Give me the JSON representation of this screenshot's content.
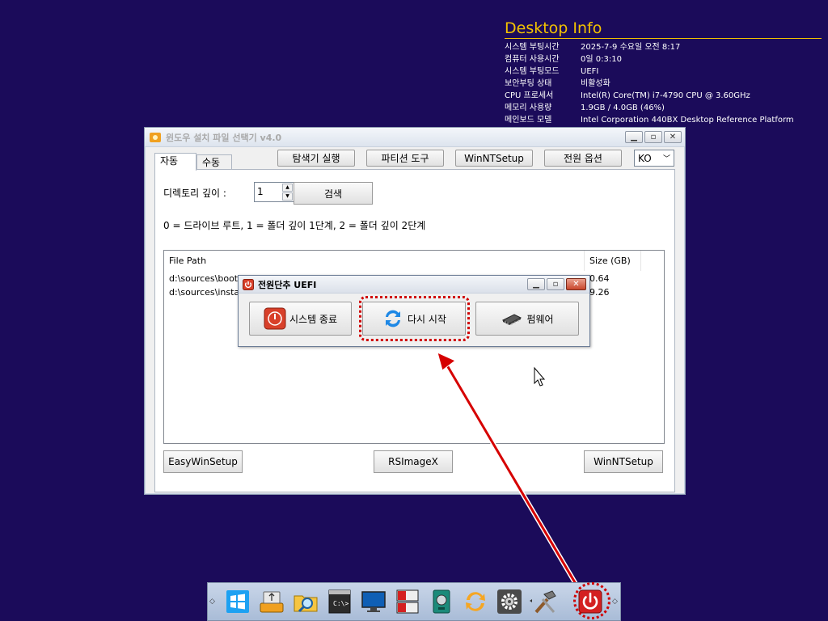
{
  "desktop_info": {
    "title": "Desktop Info",
    "rows": [
      {
        "key": "시스템 부팅시간",
        "value": "2025-7-9 수요일 오전 8:17"
      },
      {
        "key": "컴퓨터 사용시간",
        "value": "0일 0:3:10"
      },
      {
        "key": "시스템 부팅모드",
        "value": "UEFI"
      },
      {
        "key": "보안부팅 상태",
        "value": "비활성화"
      },
      {
        "key": "CPU 프로세서",
        "value": "Intel(R) Core(TM) i7-4790 CPU @ 3.60GHz"
      },
      {
        "key": "메모리 사용량",
        "value": "1.9GB / 4.0GB (46%)"
      },
      {
        "key": "메인보드 모델",
        "value": "Intel Corporation 440BX Desktop Reference Platform"
      }
    ]
  },
  "main_window": {
    "title": "윈도우 설치 파일 선택기 v4.0",
    "tabs": [
      "자동",
      "수동"
    ],
    "toolbar": {
      "explorer": "탐색기 실행",
      "partition": "파티션 도구",
      "winntsetup": "WinNTSetup",
      "power_options": "전원 옵션",
      "language": "KO"
    },
    "depth_label": "디렉토리 깊이 :",
    "depth_value": "1",
    "search_label": "검색",
    "depth_help": "0 = 드라이브 루트, 1 = 폴더 깊이 1단계, 2 = 폴더 깊이 2단계",
    "file_list": {
      "columns": [
        "File Path",
        "Size (GB)"
      ],
      "rows": [
        {
          "path": "d:\\sources\\boot.wim",
          "size": "0.64"
        },
        {
          "path": "d:\\sources\\install.esd",
          "size": "9.26"
        }
      ]
    },
    "bottom_buttons": {
      "easywinsetup": "EasyWinSetup",
      "rsimagex": "RSImageX",
      "winntsetup": "WinNTSetup"
    }
  },
  "power_dialog": {
    "title": "전원단추  UEFI",
    "shutdown": "시스템 종료",
    "restart": "다시 시작",
    "firmware": "펌웨어"
  },
  "taskbar": {
    "icons": [
      "windows-logo-icon",
      "usb-drive-icon",
      "file-search-icon",
      "command-prompt-icon",
      "monitor-icon",
      "drive-manager-icon",
      "disk-tool-icon",
      "sync-icon",
      "settings-gear-icon",
      "tools-icon",
      "power-icon"
    ]
  },
  "colors": {
    "desktop": "#1b0b5a",
    "info_title": "#f3c200",
    "highlight": "#d00000"
  }
}
